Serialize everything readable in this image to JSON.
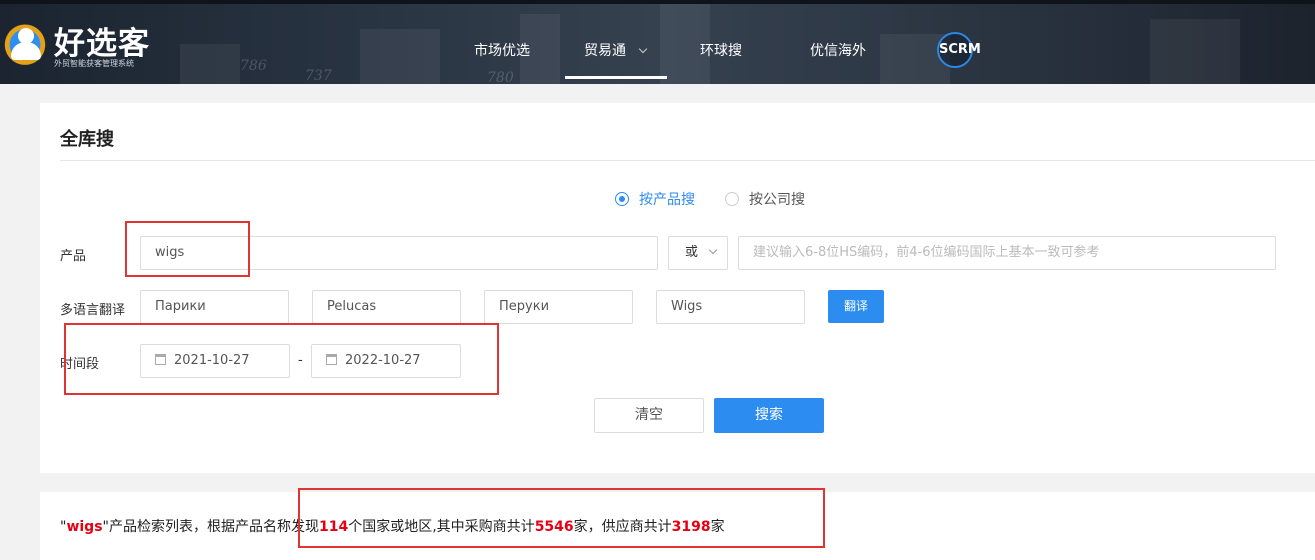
{
  "header": {
    "logo_title": "好选客",
    "logo_subtitle": "外贸智能获客管理系统",
    "bg_numbers": [
      "786",
      "737",
      "780"
    ],
    "nav": [
      {
        "label": "市场优选"
      },
      {
        "label": "贸易通"
      },
      {
        "label": "环球搜"
      },
      {
        "label": "优信海外"
      }
    ],
    "scrm_label": "SCRM"
  },
  "card": {
    "title": "全库搜",
    "radios": [
      {
        "label": "按产品搜",
        "selected": true
      },
      {
        "label": "按公司搜",
        "selected": false
      }
    ],
    "product": {
      "label": "产品",
      "value": "wigs",
      "operator": "或",
      "hs_placeholder": "建议输入6-8位HS编码，前4-6位编码国际上基本一致可参考"
    },
    "translate": {
      "label": "多语言翻译",
      "values": [
        "Парики",
        "Pelucas",
        "Перуки",
        "Wigs"
      ],
      "button": "翻译"
    },
    "period": {
      "label": "时间段",
      "start": "2021-10-27",
      "separator": "-",
      "end": "2022-10-27"
    },
    "buttons": {
      "clear": "清空",
      "search": "搜索"
    }
  },
  "result": {
    "quote_open": "\"",
    "keyword": "wigs",
    "part1": "\"产品检索列表，根据产品名称发现",
    "countries": "114",
    "part2": "个国家或地区,其中采购商共计",
    "buyers": "5546",
    "part3": "家，供应商共计",
    "suppliers": "3198",
    "part4": "家"
  },
  "colors": {
    "accent": "#2d8cf0",
    "highlight": "#e60012",
    "annotation": "#e03434"
  }
}
